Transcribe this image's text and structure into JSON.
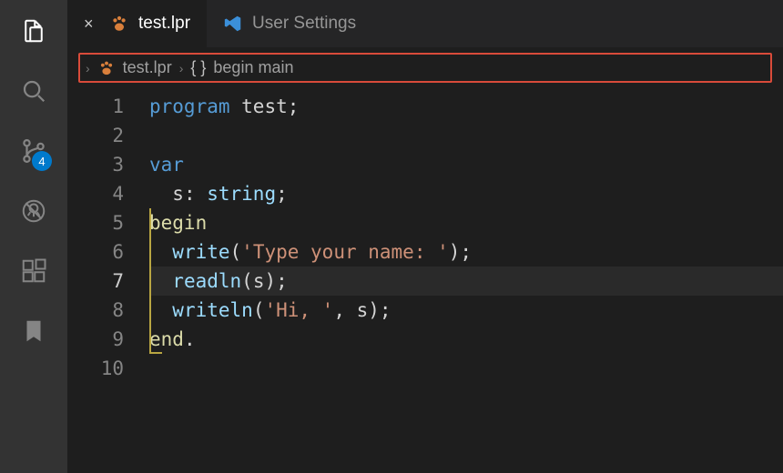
{
  "activity": {
    "scm_badge": "4"
  },
  "tabs": [
    {
      "label": "test.lpr",
      "active": true,
      "icon": "paw",
      "closable": true
    },
    {
      "label": "User Settings",
      "active": false,
      "icon": "vs",
      "closable": false
    }
  ],
  "breadcrumb": {
    "file": "test.lpr",
    "symbol_icon": "{ }",
    "symbol": "begin main"
  },
  "editor": {
    "current_line": 7,
    "lines": [
      {
        "n": 1,
        "tokens": [
          [
            "kw",
            "program "
          ],
          [
            "id",
            "test"
          ],
          [
            "punc",
            ";"
          ]
        ]
      },
      {
        "n": 2,
        "tokens": []
      },
      {
        "n": 3,
        "tokens": [
          [
            "kw",
            "var"
          ]
        ]
      },
      {
        "n": 4,
        "tokens": [
          [
            "id",
            "  s"
          ],
          [
            "punc",
            ": "
          ],
          [
            "type",
            "string"
          ],
          [
            "punc",
            ";"
          ]
        ]
      },
      {
        "n": 5,
        "tokens": [
          [
            "begin",
            "begin"
          ]
        ]
      },
      {
        "n": 6,
        "tokens": [
          [
            "id",
            "  "
          ],
          [
            "fn",
            "write"
          ],
          [
            "punc",
            "("
          ],
          [
            "str",
            "'Type your name: '"
          ],
          [
            "punc",
            ");"
          ]
        ]
      },
      {
        "n": 7,
        "tokens": [
          [
            "id",
            "  "
          ],
          [
            "fn",
            "readln"
          ],
          [
            "punc",
            "("
          ],
          [
            "id",
            "s"
          ],
          [
            "punc",
            ");"
          ]
        ]
      },
      {
        "n": 8,
        "tokens": [
          [
            "id",
            "  "
          ],
          [
            "fn",
            "writeln"
          ],
          [
            "punc",
            "("
          ],
          [
            "str",
            "'Hi, '"
          ],
          [
            "punc",
            ", "
          ],
          [
            "id",
            "s"
          ],
          [
            "punc",
            ");"
          ]
        ]
      },
      {
        "n": 9,
        "tokens": [
          [
            "end",
            "end"
          ],
          [
            "punc",
            "."
          ]
        ]
      },
      {
        "n": 10,
        "tokens": []
      }
    ]
  }
}
